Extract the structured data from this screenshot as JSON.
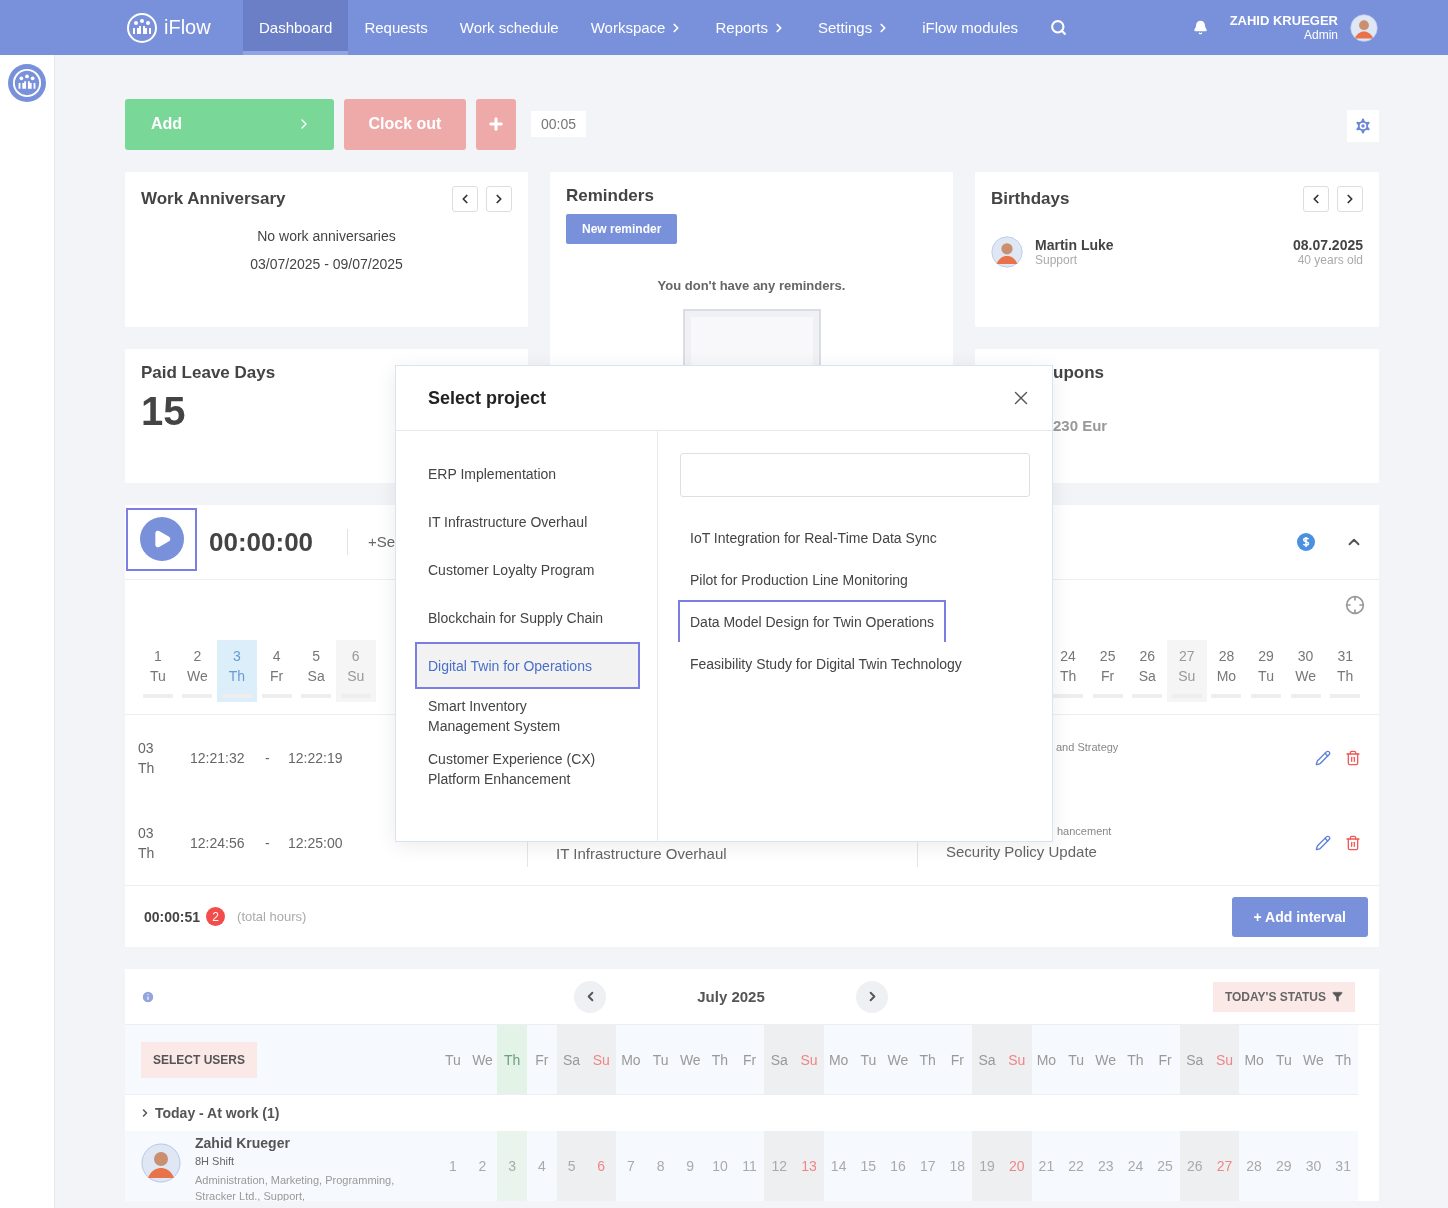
{
  "nav": {
    "logo": "iFlow",
    "items": [
      {
        "label": "Dashboard",
        "selected": true,
        "submenu": false
      },
      {
        "label": "Requests",
        "selected": false,
        "submenu": false
      },
      {
        "label": "Work schedule",
        "selected": false,
        "submenu": false
      },
      {
        "label": "Workspace",
        "selected": false,
        "submenu": true
      },
      {
        "label": "Reports",
        "selected": false,
        "submenu": true
      },
      {
        "label": "Settings",
        "selected": false,
        "submenu": true
      },
      {
        "label": "iFlow modules",
        "selected": false,
        "submenu": false
      }
    ],
    "user": {
      "name": "ZAHID KRUEGER",
      "role": "Admin"
    }
  },
  "toolbar": {
    "add": "Add",
    "clock_out": "Clock out",
    "elapsed": "00:05"
  },
  "work_anniversary": {
    "title": "Work Anniversary",
    "message": "No work anniversaries",
    "range": "03/07/2025 - 09/07/2025"
  },
  "reminders": {
    "title": "Reminders",
    "button": "New reminder",
    "empty": "You don't have any reminders."
  },
  "birthdays": {
    "title": "Birthdays",
    "people": [
      {
        "name": "Martin Luke",
        "department": "Support",
        "date": "08.07.2025",
        "age": "40 years old"
      }
    ]
  },
  "paid_leave": {
    "title": "Paid Leave Days",
    "value": "15"
  },
  "coupons": {
    "title": "upons",
    "value": "230 Eur"
  },
  "timer_panel": {
    "time": "00:00:00",
    "start_label": "+Se",
    "days_start": [
      {
        "day": "1",
        "weekday": "Tu",
        "kind": "weekday",
        "selected": false
      },
      {
        "day": "2",
        "weekday": "We",
        "kind": "weekday",
        "selected": false
      },
      {
        "day": "3",
        "weekday": "Th",
        "kind": "weekday",
        "selected": true
      },
      {
        "day": "4",
        "weekday": "Fr",
        "kind": "weekday",
        "selected": false
      },
      {
        "day": "5",
        "weekday": "Sa",
        "kind": "weekday",
        "selected": false
      },
      {
        "day": "6",
        "weekday": "Su",
        "kind": "sunday",
        "selected": false
      }
    ],
    "days_end": [
      {
        "day": "24",
        "weekday": "Th",
        "kind": "weekday",
        "selected": false
      },
      {
        "day": "25",
        "weekday": "Fr",
        "kind": "weekday",
        "selected": false
      },
      {
        "day": "26",
        "weekday": "Sa",
        "kind": "weekday",
        "selected": false
      },
      {
        "day": "27",
        "weekday": "Su",
        "kind": "sunday",
        "selected": false
      },
      {
        "day": "28",
        "weekday": "Mo",
        "kind": "weekday",
        "selected": false
      },
      {
        "day": "29",
        "weekday": "Tu",
        "kind": "weekday",
        "selected": false
      },
      {
        "day": "30",
        "weekday": "We",
        "kind": "weekday",
        "selected": false
      },
      {
        "day": "31",
        "weekday": "Th",
        "kind": "weekday",
        "selected": false
      }
    ],
    "intervals": [
      {
        "date": "03",
        "weekday": "Th",
        "start": "12:21:32",
        "separator": "-",
        "end": "12:22:19",
        "project_tail": "and Strategy"
      },
      {
        "date": "03",
        "weekday": "Th",
        "start": "12:24:56",
        "separator": "-",
        "end": "12:25:00",
        "project": "IT Infrastructure Overhaul",
        "task": "Security Policy Update",
        "project_tail": "hancement"
      }
    ],
    "total": "00:00:51",
    "count": "2",
    "total_label": "(total hours)",
    "add_interval": "+ Add interval"
  },
  "calendar": {
    "month": "July 2025",
    "status_button": "TODAY'S STATUS",
    "select_users": "SELECT USERS",
    "group": "Today - At work (1)",
    "user": {
      "name": "Zahid Krueger",
      "shift": "8H Shift",
      "departments": "Administration, Marketing, Programming, Stracker Ltd., Support,"
    },
    "days": [
      {
        "day": "1",
        "weekday": "Tu",
        "kind": "weekday",
        "today": false
      },
      {
        "day": "2",
        "weekday": "We",
        "kind": "weekday",
        "today": false
      },
      {
        "day": "3",
        "weekday": "Th",
        "kind": "weekday",
        "today": true
      },
      {
        "day": "4",
        "weekday": "Fr",
        "kind": "weekday",
        "today": false
      },
      {
        "day": "5",
        "weekday": "Sa",
        "kind": "saturday",
        "today": false
      },
      {
        "day": "6",
        "weekday": "Su",
        "kind": "sunday",
        "today": false
      },
      {
        "day": "7",
        "weekday": "Mo",
        "kind": "weekday",
        "today": false
      },
      {
        "day": "8",
        "weekday": "Tu",
        "kind": "weekday",
        "today": false
      },
      {
        "day": "9",
        "weekday": "We",
        "kind": "weekday",
        "today": false
      },
      {
        "day": "10",
        "weekday": "Th",
        "kind": "weekday",
        "today": false
      },
      {
        "day": "11",
        "weekday": "Fr",
        "kind": "weekday",
        "today": false
      },
      {
        "day": "12",
        "weekday": "Sa",
        "kind": "saturday",
        "today": false
      },
      {
        "day": "13",
        "weekday": "Su",
        "kind": "sunday",
        "today": false
      },
      {
        "day": "14",
        "weekday": "Mo",
        "kind": "weekday",
        "today": false
      },
      {
        "day": "15",
        "weekday": "Tu",
        "kind": "weekday",
        "today": false
      },
      {
        "day": "16",
        "weekday": "We",
        "kind": "weekday",
        "today": false
      },
      {
        "day": "17",
        "weekday": "Th",
        "kind": "weekday",
        "today": false
      },
      {
        "day": "18",
        "weekday": "Fr",
        "kind": "weekday",
        "today": false
      },
      {
        "day": "19",
        "weekday": "Sa",
        "kind": "saturday",
        "today": false
      },
      {
        "day": "20",
        "weekday": "Su",
        "kind": "sunday",
        "today": false
      },
      {
        "day": "21",
        "weekday": "Mo",
        "kind": "weekday",
        "today": false
      },
      {
        "day": "22",
        "weekday": "Tu",
        "kind": "weekday",
        "today": false
      },
      {
        "day": "23",
        "weekday": "We",
        "kind": "weekday",
        "today": false
      },
      {
        "day": "24",
        "weekday": "Th",
        "kind": "weekday",
        "today": false
      },
      {
        "day": "25",
        "weekday": "Fr",
        "kind": "weekday",
        "today": false
      },
      {
        "day": "26",
        "weekday": "Sa",
        "kind": "saturday",
        "today": false
      },
      {
        "day": "27",
        "weekday": "Su",
        "kind": "sunday",
        "today": false
      },
      {
        "day": "28",
        "weekday": "Mo",
        "kind": "weekday",
        "today": false
      },
      {
        "day": "29",
        "weekday": "Tu",
        "kind": "weekday",
        "today": false
      },
      {
        "day": "30",
        "weekday": "We",
        "kind": "weekday",
        "today": false
      },
      {
        "day": "31",
        "weekday": "Th",
        "kind": "weekday",
        "today": false
      }
    ]
  },
  "project_dialog": {
    "title": "Select project",
    "projects": [
      {
        "label": "ERP Implementation",
        "selected": false
      },
      {
        "label": "IT Infrastructure Overhaul",
        "selected": false
      },
      {
        "label": "Customer Loyalty Program",
        "selected": false
      },
      {
        "label": "Blockchain for Supply Chain",
        "selected": false
      },
      {
        "label": "Digital Twin for Operations",
        "selected": true
      },
      {
        "label": "Smart Inventory\nManagement System",
        "selected": false
      },
      {
        "label": "Customer Experience (CX)\nPlatform Enhancement",
        "selected": false
      }
    ],
    "tasks": [
      {
        "label": "IoT Integration for Real-Time Data Sync",
        "selected": false
      },
      {
        "label": "Pilot for Production Line Monitoring",
        "selected": false
      },
      {
        "label": "Data Model Design for Twin Operations",
        "selected": true
      },
      {
        "label": "Feasibility Study for Digital Twin Technology",
        "selected": false
      }
    ]
  }
}
